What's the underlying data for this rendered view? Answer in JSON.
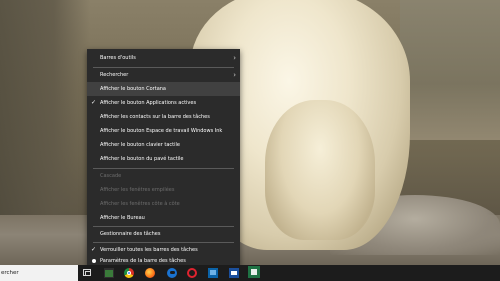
{
  "menu": {
    "items": [
      {
        "label": "Barres d'outils",
        "submenu": true
      },
      {
        "label": "Rechercher",
        "submenu": true
      },
      {
        "label": "Afficher le bouton Cortana",
        "highlighted": true
      },
      {
        "label": "Afficher le bouton Applications actives",
        "checked": true
      },
      {
        "label": "Afficher les contacts sur la barre des tâches"
      },
      {
        "label": "Afficher le bouton Espace de travail Windows Ink"
      },
      {
        "label": "Afficher le bouton clavier tactile"
      },
      {
        "label": "Afficher le bouton du pavé tactile"
      },
      {
        "label": "Cascade",
        "disabled": true
      },
      {
        "label": "Afficher les fenêtres empilées",
        "disabled": true
      },
      {
        "label": "Afficher les fenêtres côte à côte",
        "disabled": true
      },
      {
        "label": "Afficher le Bureau"
      },
      {
        "label": "Gestionnaire des tâches"
      },
      {
        "label": "Verrouiller toutes les barres des tâches",
        "checked": true
      },
      {
        "label": "Paramètres de la barre des tâches",
        "icon": "settings-dot-icon"
      }
    ]
  },
  "taskbar": {
    "search_text": "ercher",
    "icons": [
      "task-view-icon",
      "store-icon",
      "chrome-icon",
      "firefox-icon",
      "edge-icon",
      "opera-icon",
      "app-icon",
      "mail-icon",
      "excel-icon"
    ]
  },
  "colors": {
    "menu_bg": "#2b2b2b",
    "menu_highlight": "#414141",
    "menu_disabled_text": "#6d6d6d",
    "taskbar_bg": "#1c1c1c"
  }
}
